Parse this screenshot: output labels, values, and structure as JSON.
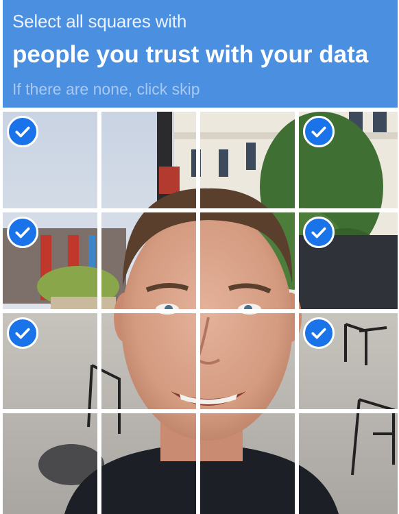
{
  "header": {
    "prompt": "Select all squares with",
    "target": "people you trust with your data",
    "hint": "If there are none, click skip"
  },
  "colors": {
    "header_bg": "#4a8fe0",
    "check_bg": "#1a73e8",
    "grid_line": "#ffffff"
  },
  "grid": {
    "rows": 4,
    "cols": 4,
    "tiles": [
      {
        "selected": true
      },
      {
        "selected": false
      },
      {
        "selected": false
      },
      {
        "selected": true
      },
      {
        "selected": true
      },
      {
        "selected": false
      },
      {
        "selected": false
      },
      {
        "selected": true
      },
      {
        "selected": true
      },
      {
        "selected": false
      },
      {
        "selected": false
      },
      {
        "selected": true
      },
      {
        "selected": false
      },
      {
        "selected": false
      },
      {
        "selected": false
      },
      {
        "selected": false
      }
    ]
  },
  "icons": {
    "check": "checkmark-icon"
  }
}
